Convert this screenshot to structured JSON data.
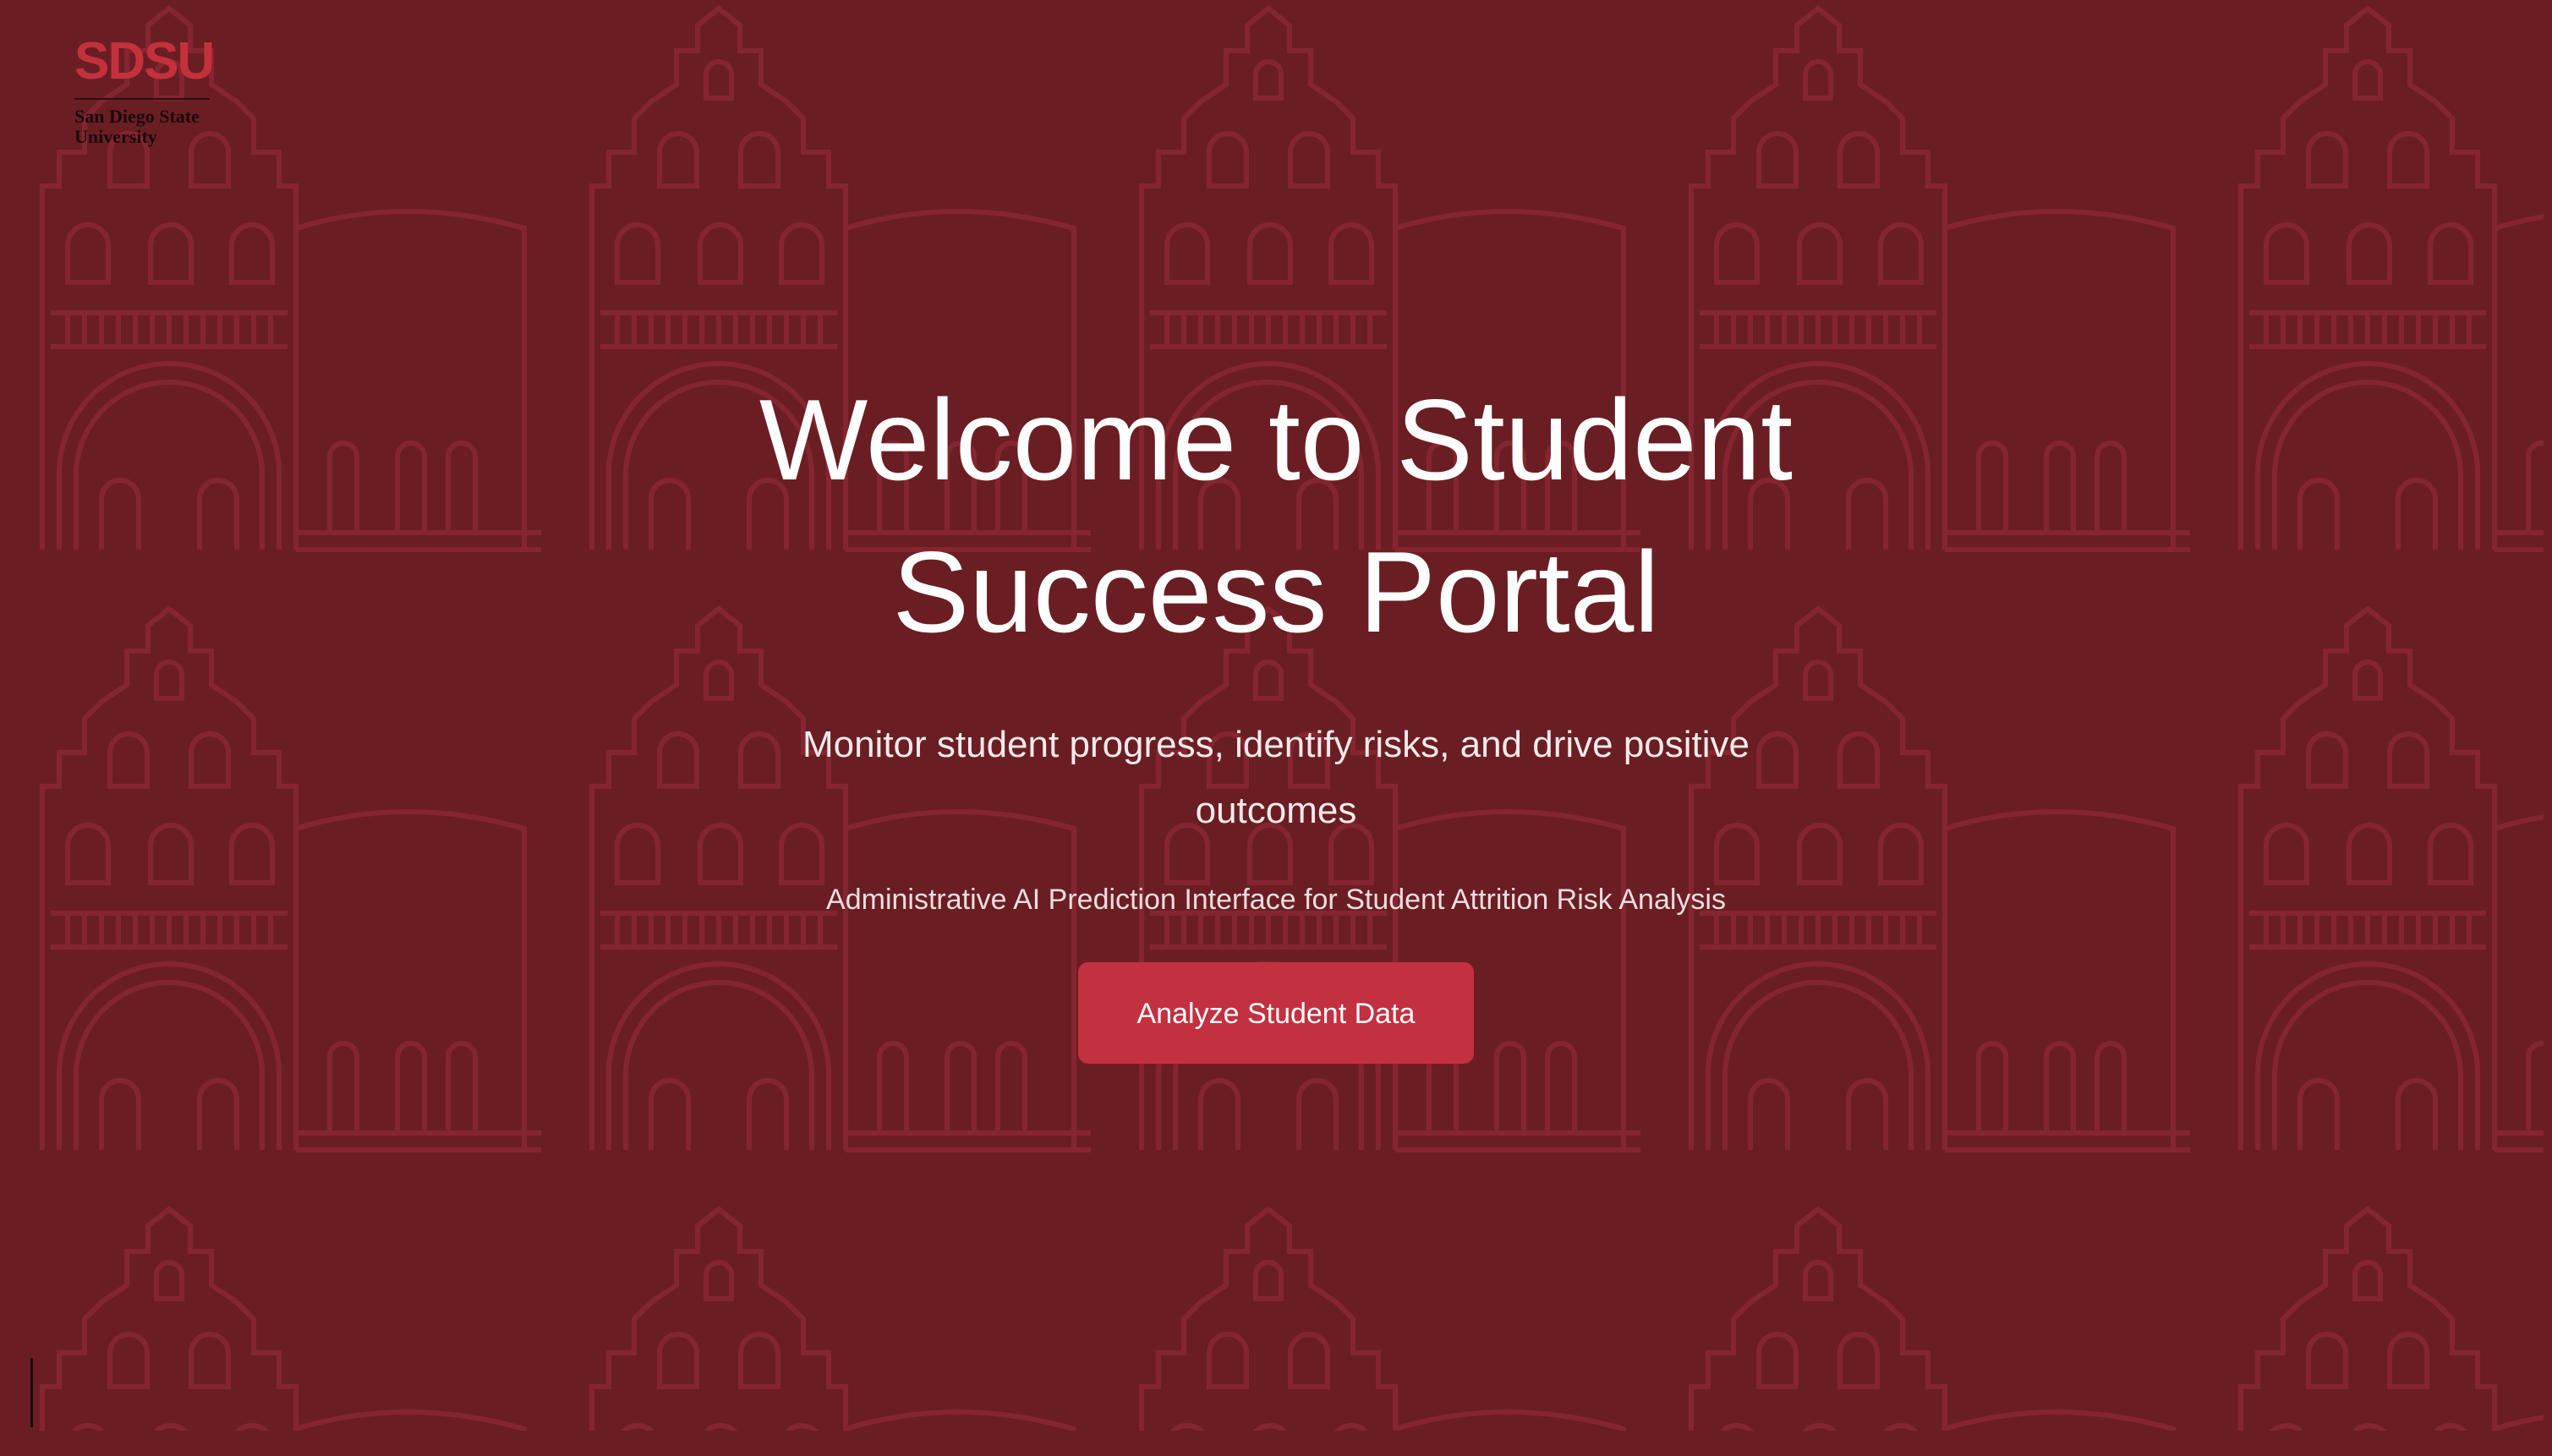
{
  "brand": {
    "logo_mark": "SDSU",
    "logo_line1": "San Diego State",
    "logo_line2": "University"
  },
  "hero": {
    "title": "Welcome to Student Success Portal",
    "subtitle": "Monitor student progress, identify risks, and drive positive outcomes",
    "caption": "Administrative AI Prediction Interface for Student Attrition Risk Analysis",
    "cta_label": "Analyze Student Data"
  },
  "colors": {
    "background": "#6a1e24",
    "pattern": "#8a2632",
    "accent": "#c3303f",
    "text": "#ffffff"
  },
  "icons": {
    "background_motif": "building-facade-pattern"
  }
}
